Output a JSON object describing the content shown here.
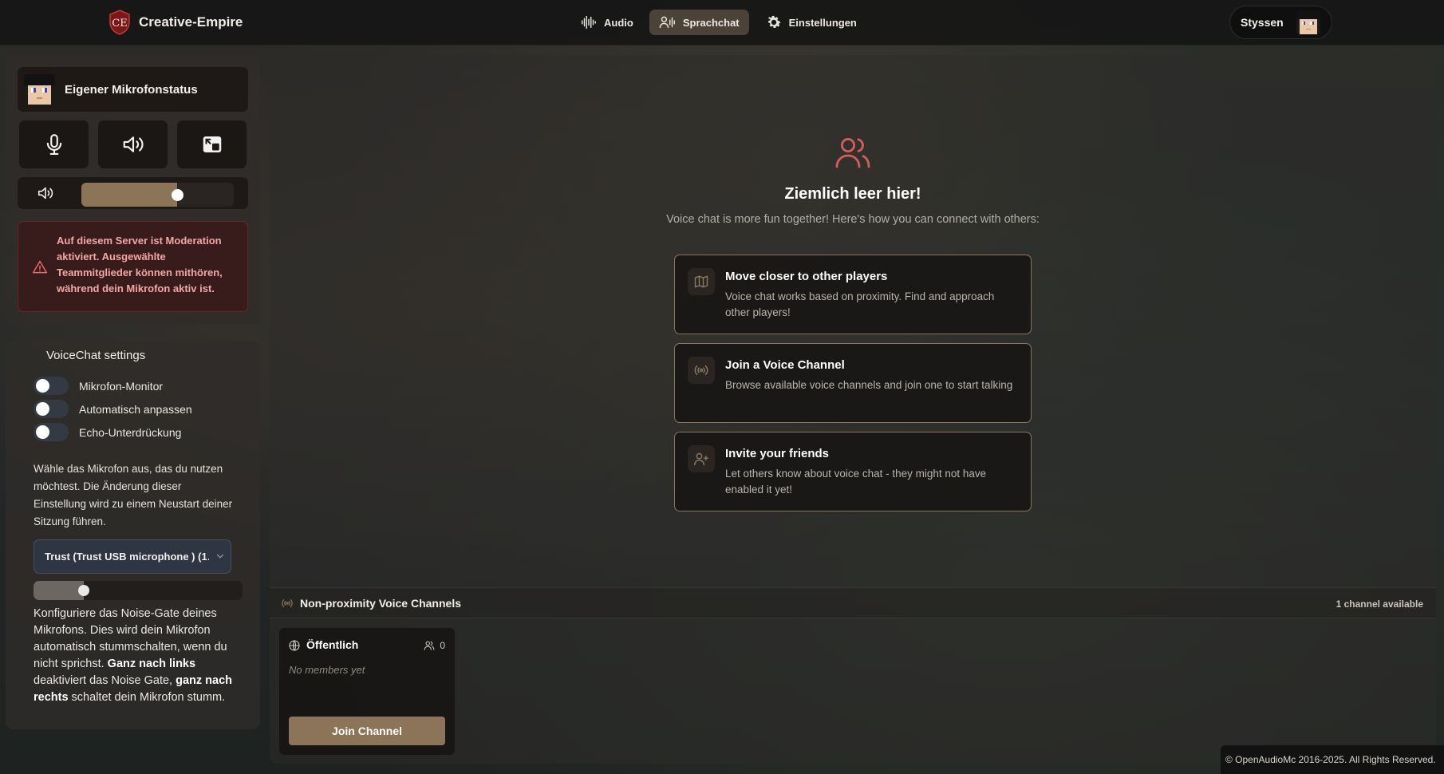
{
  "header": {
    "brand_name": "Creative-Empire",
    "nav": [
      {
        "label": "Audio",
        "icon": "audio-wave-icon",
        "active": false
      },
      {
        "label": "Sprachchat",
        "icon": "voice-chat-icon",
        "active": true
      },
      {
        "label": "Einstellungen",
        "icon": "gear-icon",
        "active": false
      }
    ],
    "user_name": "Styssen"
  },
  "mic_panel": {
    "title": "Eigener Mikrofonstatus",
    "controls": [
      "microphone-icon",
      "speaker-icon",
      "picture-in-picture-icon"
    ],
    "volume_level": 0.63,
    "moderation_notice": "Auf diesem Server ist Moderation aktiviert. Ausgewählte Teammitglieder können mithören, während dein Mikrofon aktiv ist."
  },
  "voicechat_settings": {
    "title": "VoiceChat settings",
    "toggles": [
      {
        "label": "Mikrofon-Monitor",
        "on": false
      },
      {
        "label": "Automatisch anpassen",
        "on": false
      },
      {
        "label": "Echo-Unterdrückung",
        "on": false
      }
    ],
    "mic_select_help": "Wähle das Mikrofon aus, das du nutzen möchtest. Die Änderung dieser Einstellung wird zu einem Neustart deiner Sitzung führen.",
    "mic_select_value": "Trust (Trust USB microphone ) (1…",
    "noise_gate_level": 0.24,
    "noise_gate_help_1": "Konfiguriere das Noise-Gate deines Mikrofons. Dies wird dein Mikrofon automatisch stummschalten, wenn du nicht sprichst. ",
    "noise_gate_bold_1": "Ganz nach links",
    "noise_gate_help_2": " deaktiviert das Noise Gate, ",
    "noise_gate_bold_2": "ganz nach rechts",
    "noise_gate_help_3": " schaltet dein Mikrofon stumm."
  },
  "main": {
    "empty_title": "Ziemlich leer hier!",
    "empty_subtitle": "Voice chat is more fun together! Here's how you can connect with others:",
    "tips": [
      {
        "title": "Move closer to other players",
        "desc": "Voice chat works based on proximity. Find and approach other players!",
        "icon": "map-icon"
      },
      {
        "title": "Join a Voice Channel",
        "desc": "Browse available voice channels and join one to start talking",
        "icon": "broadcast-icon"
      },
      {
        "title": "Invite your friends",
        "desc": "Let others know about voice chat - they might not have enabled it yet!",
        "icon": "user-plus-icon"
      }
    ],
    "channels_title": "Non-proximity Voice Channels",
    "channels_count": "1 channel available",
    "channel": {
      "name": "Öffentlich",
      "member_count": "0",
      "empty_text": "No members yet",
      "join_label": "Join Channel"
    }
  },
  "footer": "© OpenAudioMc 2016-2025. All Rights Reserved.",
  "colors": {
    "accent": "#8c7458",
    "active_nav": "#4c4338",
    "warning_text": "#f4a6a6",
    "empty_icon": "#d0605a"
  }
}
